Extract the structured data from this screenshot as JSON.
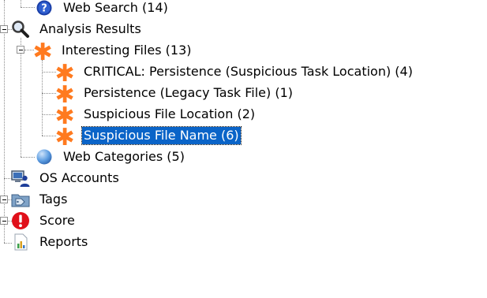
{
  "tree": {
    "web_search": {
      "label": "Web Search (14)",
      "icon": "question-icon"
    },
    "analysis_results": {
      "label": "Analysis Results",
      "icon": "magnifier-icon"
    },
    "interesting_files": {
      "label": "Interesting Files (13)",
      "icon": "asterisk-icon"
    },
    "children": [
      {
        "label": "CRITICAL: Persistence (Suspicious Task Location) (4)",
        "icon": "asterisk-icon"
      },
      {
        "label": "Persistence (Legacy Task File) (1)",
        "icon": "asterisk-icon"
      },
      {
        "label": "Suspicious File Location (2)",
        "icon": "asterisk-icon"
      },
      {
        "label": "Suspicious File Name (6)",
        "icon": "asterisk-icon",
        "selected": true
      }
    ],
    "web_categories": {
      "label": "Web Categories (5)",
      "icon": "globe-icon"
    },
    "os_accounts": {
      "label": "OS Accounts",
      "icon": "user-computer-icon"
    },
    "tags": {
      "label": "Tags",
      "icon": "tag-folder-icon"
    },
    "score": {
      "label": "Score",
      "icon": "exclamation-icon"
    },
    "reports": {
      "label": "Reports",
      "icon": "report-icon"
    }
  },
  "colors": {
    "selection": "#0a64c8",
    "asterisk": "#ff7a1f",
    "score_red": "#e0101a",
    "globe_blue": "#4a8fd8"
  }
}
